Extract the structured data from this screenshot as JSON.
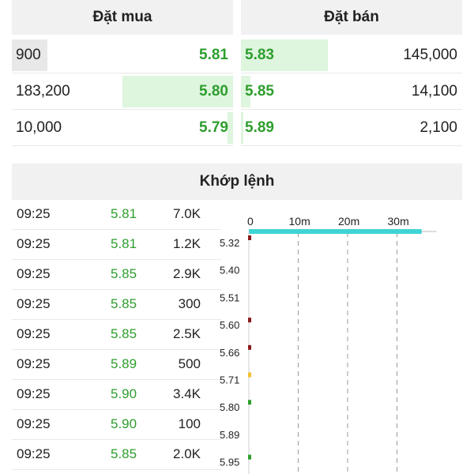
{
  "order_book": {
    "buy_title": "Đặt mua",
    "sell_title": "Đặt bán",
    "buy": [
      {
        "qty": "900",
        "price": "5.81"
      },
      {
        "qty": "183,200",
        "price": "5.80"
      },
      {
        "qty": "10,000",
        "price": "5.79"
      }
    ],
    "sell": [
      {
        "price": "5.83",
        "qty": "145,000"
      },
      {
        "price": "5.85",
        "qty": "14,100"
      },
      {
        "price": "5.89",
        "qty": "2,100"
      }
    ]
  },
  "matched": {
    "title": "Khớp lệnh",
    "trades": [
      {
        "time": "09:25",
        "price": "5.81",
        "volume": "7.0K"
      },
      {
        "time": "09:25",
        "price": "5.81",
        "volume": "1.2K"
      },
      {
        "time": "09:25",
        "price": "5.85",
        "volume": "2.9K"
      },
      {
        "time": "09:25",
        "price": "5.85",
        "volume": "300"
      },
      {
        "time": "09:25",
        "price": "5.85",
        "volume": "2.5K"
      },
      {
        "time": "09:25",
        "price": "5.89",
        "volume": "500"
      },
      {
        "time": "09:25",
        "price": "5.90",
        "volume": "3.4K"
      },
      {
        "time": "09:25",
        "price": "5.90",
        "volume": "100"
      },
      {
        "time": "09:25",
        "price": "5.85",
        "volume": "2.0K"
      }
    ]
  },
  "colors": {
    "green": "#2e9e2e",
    "bar_bg": "#def5de",
    "cyan": "#3fd4d4",
    "dark_red": "#8b1a1a",
    "yellow": "#f2c12e"
  },
  "chart_data": {
    "type": "bar",
    "orientation": "horizontal",
    "x_ticks": [
      "0",
      "10m",
      "20m",
      "30m"
    ],
    "xlim": [
      0,
      38
    ],
    "categories": [
      "5.32",
      "5.40",
      "5.51",
      "5.60",
      "5.66",
      "5.71",
      "5.80",
      "5.89",
      "5.95"
    ],
    "top_bar": {
      "value": 35,
      "color": "#3fd4d4"
    },
    "markers": [
      {
        "category": "5.32",
        "color": "#8b1a1a"
      },
      {
        "category": "5.60",
        "color": "#8b1a1a"
      },
      {
        "category": "5.66",
        "color": "#8b1a1a"
      },
      {
        "category": "5.71",
        "color": "#f2c12e"
      },
      {
        "category": "5.80",
        "color": "#2e9e2e"
      },
      {
        "category": "5.95",
        "color": "#2e9e2e"
      }
    ]
  }
}
